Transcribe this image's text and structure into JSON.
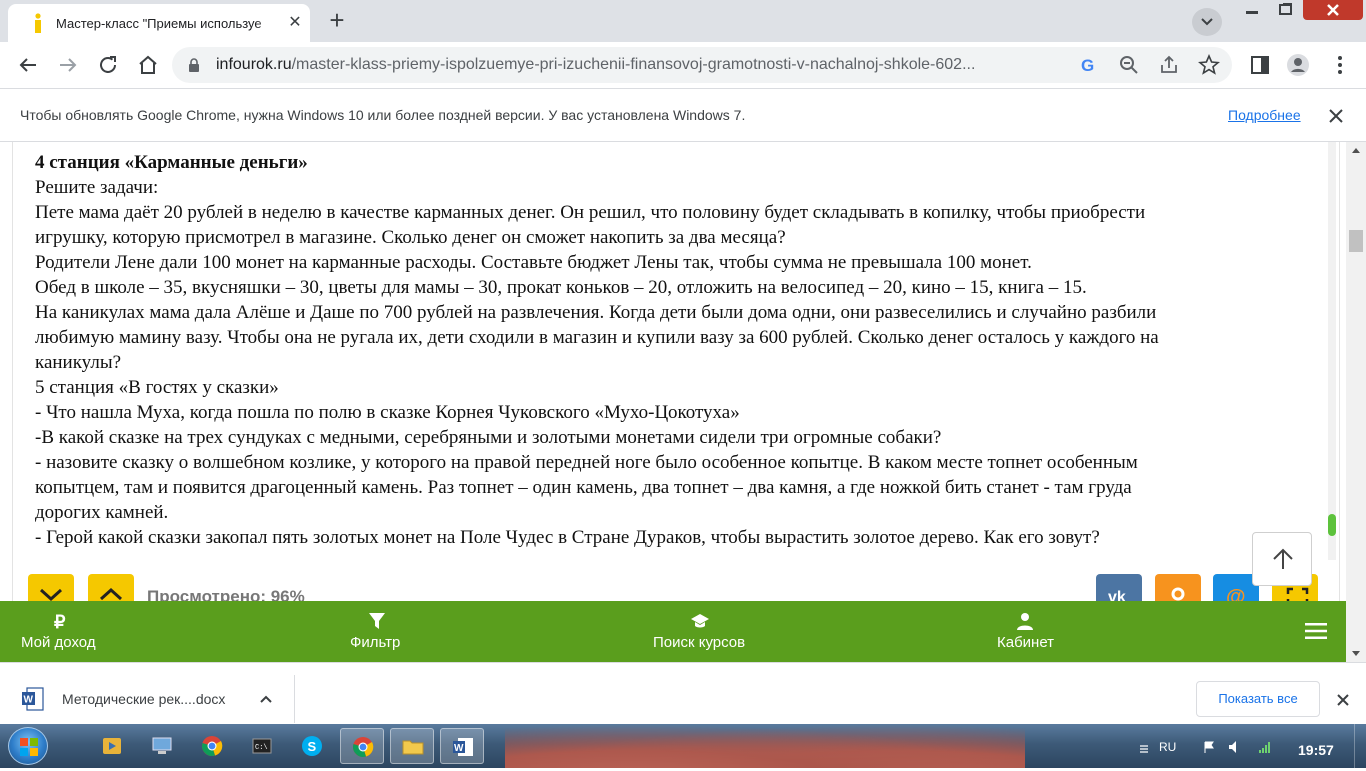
{
  "browser": {
    "tab_title": "Мастер-класс \"Приемы используе",
    "url_host": "infourok.ru",
    "url_path": "/master-klass-priemy-ispolzuemye-pri-izuchenii-finansovoj-gramotnosti-v-nachalnoj-shkole-602..."
  },
  "infobar": {
    "message": "Чтобы обновлять Google Chrome, нужна Windows 10 или более поздней версии. У вас установлена Windows 7.",
    "link": "Подробнее"
  },
  "document": {
    "lines": [
      "4 станция «Карманные деньги»",
      "Решите задачи:",
      "Пете мама даёт 20 рублей в неделю в качестве карманных денег. Он решил, что половину будет складывать в копилку, чтобы приобрести",
      "игрушку, которую присмотрел в магазине. Сколько денег он сможет накопить за два месяца?",
      "Родители Лене дали 100 монет на карманные расходы. Составьте бюджет Лены так, чтобы сумма не превышала 100 монет.",
      "Обед в школе – 35, вкусняшки – 30, цветы для мамы – 30, прокат коньков – 20, отложить на велосипед – 20, кино – 15, книга – 15.",
      "На каникулах мама дала Алёше и Даше по 700 рублей на развлечения. Когда дети были дома одни, они развеселились и случайно разбили",
      "любимую мамину вазу. Чтобы она не ругала их, дети сходили в магазин и купили вазу за 600 рублей. Сколько денег осталось у каждого на",
      "каникулы?",
      "5 станция «В гостях у сказки»",
      "- Что нашла Муха, когда пошла по полю в сказке Корнея Чуковского «Мухо-Цокотуха»",
      "-В какой сказке на трех сундуках с медными, серебряными и золотыми монетами сидели три огромные собаки?",
      "- назовите сказку о волшебном козлике, у которого на правой передней ноге было особенное копытце. В каком месте топнет особенным",
      "копытцем, там и появится драгоценный камень. Раз топнет – один камень, два топнет – два камня, а где ножкой бить станет - там груда",
      "дорогих камней.",
      "- Герой какой сказки закопал пять золотых монет на Поле Чудес в Стране Дураков, чтобы вырастить золотое дерево. Как его зовут?"
    ],
    "viewed": "Просмотрено: 96%"
  },
  "bottom_nav": {
    "items": [
      {
        "label": "Мой доход",
        "icon": "ruble-icon"
      },
      {
        "label": "Фильтр",
        "icon": "filter-icon"
      },
      {
        "label": "Поиск курсов",
        "icon": "graduation-cap-icon"
      },
      {
        "label": "Кабинет",
        "icon": "user-icon"
      }
    ],
    "menu_icon": "hamburger-menu-icon"
  },
  "downloads": {
    "file_name": "Методические рек....docx",
    "show_all": "Показать все"
  },
  "taskbar": {
    "language": "RU",
    "time": "19:57"
  },
  "colors": {
    "nav_green": "#5a9e1d",
    "accent_yellow": "#f5c800",
    "vk_blue": "#4c75a3",
    "ok_orange": "#f7931e",
    "mail_blue": "#168de2"
  }
}
